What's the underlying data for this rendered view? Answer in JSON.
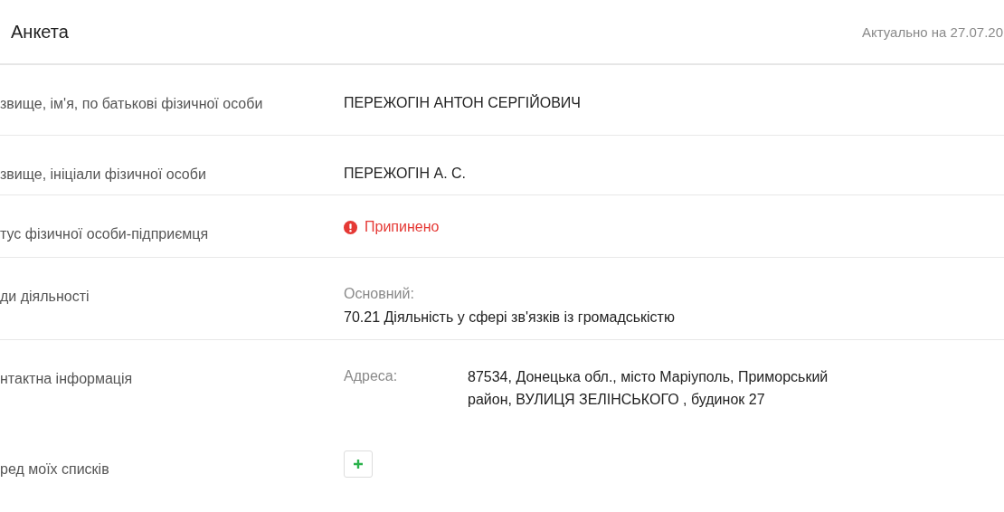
{
  "header": {
    "title": "Анкета",
    "updated": "Актуально на 27.07.20"
  },
  "rows": [
    {
      "kind": "text",
      "label": "звище, ім'я, по батькові фізичної особи",
      "value": "ПЕРЕЖОГІН АНТОН СЕРГІЙОВИЧ"
    },
    {
      "kind": "text",
      "label": "звище, ініціали фізичної особи",
      "value": "ПЕРЕЖОГІН А. С."
    },
    {
      "kind": "status",
      "label": "тус фізичної особи-підприємця",
      "value": "Припинено",
      "color": "#e53935"
    },
    {
      "kind": "activity",
      "label": "ди діяльності",
      "caption": "Основний:",
      "value": "70.21 Діяльність у сфері зв'язків із громадськістю"
    },
    {
      "kind": "address",
      "label": "нтактна інформація",
      "caption": "Адреса:",
      "value": "87534, Донецька обл., місто Маріуполь, Приморський район, ВУЛИЦЯ ЗЕЛІНСЬКОГО , будинок 27"
    },
    {
      "kind": "add",
      "label": "ред моїх списків"
    }
  ]
}
